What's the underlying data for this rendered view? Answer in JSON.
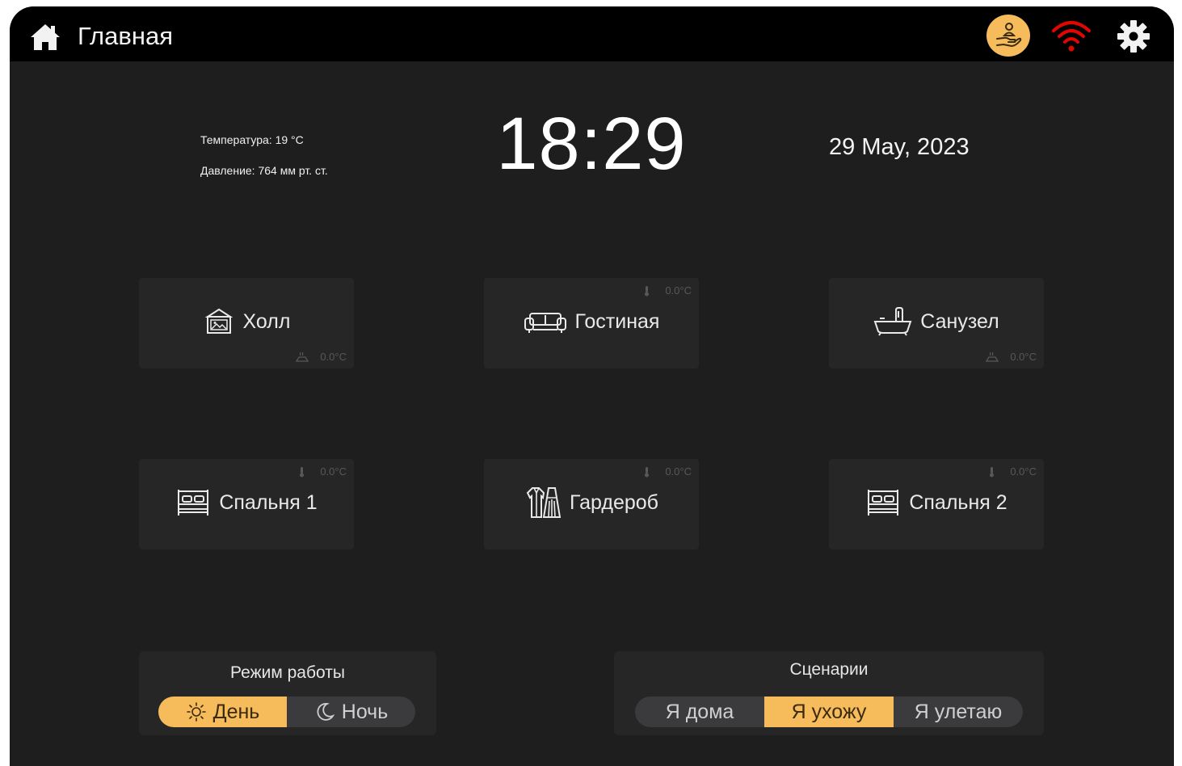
{
  "header": {
    "title": "Главная",
    "icons": [
      "home-icon",
      "service-hand-icon",
      "wifi-icon",
      "gear-icon"
    ],
    "wifi_color": "#e10600",
    "service_badge_color": "#f6bb5a"
  },
  "weather": {
    "temperature": "Температура: 19 °С",
    "pressure": "Давление: 764 мм рт. ст."
  },
  "clock": {
    "time": "18:29",
    "date": "29 May, 2023"
  },
  "rooms": [
    {
      "label": "Холл",
      "temp": "0.0°С",
      "icon": "picture-frame-icon",
      "temp_icon": "floor-heating-icon"
    },
    {
      "label": "Гостиная",
      "temp": "0.0°С",
      "icon": "sofa-icon",
      "temp_icon": "thermometer-icon"
    },
    {
      "label": "Санузел",
      "temp": "0.0°С",
      "icon": "bathtub-icon",
      "temp_icon": "floor-heating-icon"
    },
    {
      "label": "Спальня 1",
      "temp": "0.0°С",
      "icon": "bed-icon",
      "temp_icon": "thermometer-icon"
    },
    {
      "label": "Гардероб",
      "temp": "0.0°С",
      "icon": "wardrobe-clothes-icon",
      "temp_icon": "thermometer-icon"
    },
    {
      "label": "Спальня 2",
      "temp": "0.0°С",
      "icon": "bed-icon",
      "temp_icon": "thermometer-icon"
    }
  ],
  "mode": {
    "title": "Режим работы",
    "options": [
      {
        "label": "День",
        "icon": "sun-icon",
        "active": true
      },
      {
        "label": "Ночь",
        "icon": "moon-icon",
        "active": false
      }
    ]
  },
  "scenarios": {
    "title": "Сценарии",
    "options": [
      {
        "label": "Я дома",
        "active": false
      },
      {
        "label": "Я ухожу",
        "active": true
      },
      {
        "label": "Я улетаю",
        "active": false
      }
    ]
  },
  "colors": {
    "accent": "#f6bb5a",
    "background": "#1e1e1f",
    "card": "#262627",
    "topbar": "#000000"
  }
}
